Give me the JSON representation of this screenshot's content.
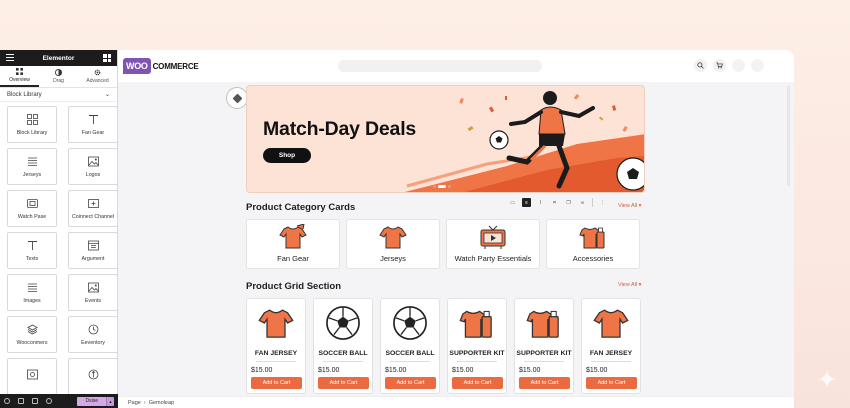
{
  "sidebar": {
    "title": "Elementor",
    "tabs": [
      {
        "label": "Overview",
        "icon": "grid-icon"
      },
      {
        "label": "Drag",
        "icon": "drag-icon"
      },
      {
        "label": "Advanced",
        "icon": "gear-icon"
      }
    ],
    "section": "Block Library",
    "blocks": [
      {
        "label": "Block Library",
        "icon": "grid-icon"
      },
      {
        "label": "Fan Gear",
        "icon": "text-icon"
      },
      {
        "label": "Jerseys",
        "icon": "list-icon"
      },
      {
        "label": "Logos",
        "icon": "image-icon"
      },
      {
        "label": "Watch Pase",
        "icon": "video-icon"
      },
      {
        "label": "Coinnect Channel",
        "icon": "plus-box-icon"
      },
      {
        "label": "Texts",
        "icon": "text-icon"
      },
      {
        "label": "Argument",
        "icon": "calendar-icon"
      },
      {
        "label": "Images",
        "icon": "list-icon"
      },
      {
        "label": "Events",
        "icon": "image-icon"
      },
      {
        "label": "Wooconmers",
        "icon": "layers-icon"
      },
      {
        "label": "Eeventory",
        "icon": "clock-icon"
      },
      {
        "label": "",
        "icon": "image-icon"
      },
      {
        "label": "",
        "icon": "arrows-icon"
      }
    ],
    "publish_label": "Dsise"
  },
  "header": {
    "logo_woo": "WOO",
    "logo_commerce": "COMMERCE"
  },
  "hero": {
    "title": "Match-Day Deals",
    "button": "Shop"
  },
  "categories": {
    "title": "Product Category Cards",
    "view_all": "View All ▾",
    "items": [
      {
        "label": "Fan Gear",
        "icon": "jersey-icon"
      },
      {
        "label": "Jerseys",
        "icon": "jersey-icon"
      },
      {
        "label": "Watch Party Essentials",
        "icon": "tv-icon"
      },
      {
        "label": "Accessories",
        "icon": "kit-icon"
      }
    ]
  },
  "products": {
    "title": "Product Grid Section",
    "view_all": "View All ▾",
    "items": [
      {
        "name": "FAN JERSEY",
        "price": "$15.00",
        "cart": "Add to Cart",
        "icon": "jersey-icon"
      },
      {
        "name": "SOCCER BALL",
        "price": "$15.00",
        "cart": "Add to Cart",
        "icon": "ball-icon"
      },
      {
        "name": "SOCCER BALL",
        "price": "$15.00",
        "cart": "Add to Cart",
        "icon": "ball-icon"
      },
      {
        "name": "SUPPORTER KIT",
        "price": "$15.00",
        "cart": "Add to Cart",
        "icon": "kit-icon"
      },
      {
        "name": "SUPPORTER KIT",
        "price": "$15.00",
        "cart": "Add to Cart",
        "icon": "kit-icon"
      },
      {
        "name": "FAN JERSEY",
        "price": "$15.00",
        "cart": "Add to Cart",
        "icon": "jersey-icon"
      }
    ]
  },
  "status_bar": {
    "page": "Page",
    "sep": "›",
    "item": "Gemoleap"
  },
  "colors": {
    "accent": "#ec6a3f",
    "woo_purple": "#7f54b3",
    "publish": "#d7a8e8"
  }
}
